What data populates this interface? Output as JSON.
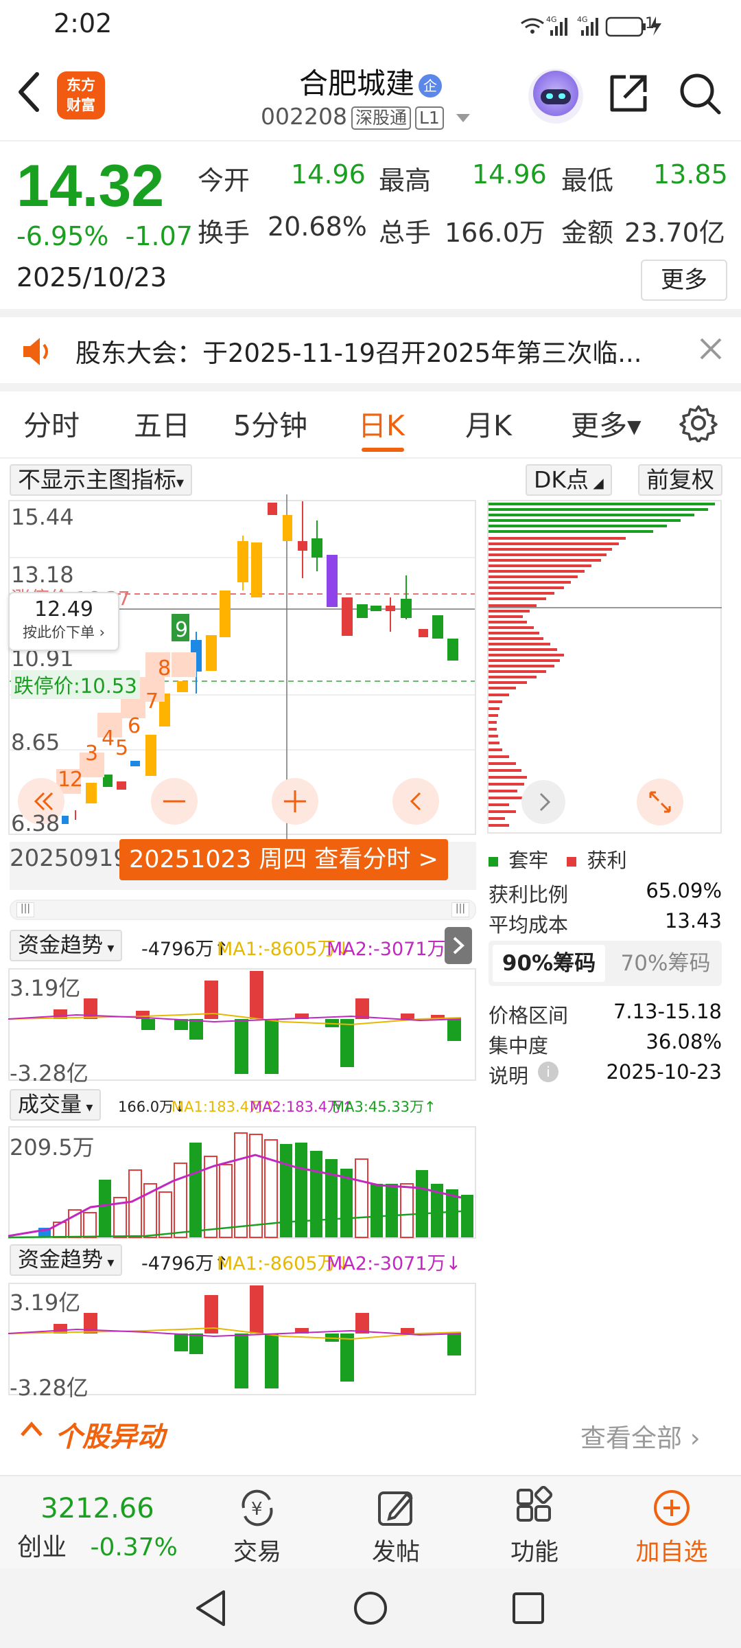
{
  "status_bar": {
    "time": "2:02",
    "battery": "1"
  },
  "header": {
    "logo_line1": "东方",
    "logo_line2": "财富",
    "stock_name": "合肥城建",
    "badge": "企",
    "stock_code": "002208",
    "tag1": "深股通",
    "tag2": "L1"
  },
  "quote": {
    "price": "14.32",
    "change_pct": "-6.95%",
    "change_amt": "-1.07",
    "date": "2025/10/23",
    "open_label": "今开",
    "open": "14.96",
    "high_label": "最高",
    "high": "14.96",
    "low_label": "最低",
    "low": "13.85",
    "turnover_label": "换手",
    "turnover": "20.68%",
    "volume_label": "总手",
    "volume": "166.0万",
    "amount_label": "金额",
    "amount": "23.70亿",
    "more_label": "更多"
  },
  "notice": {
    "text": "股东大会：于2025-11-19召开2025年第三次临..."
  },
  "tabs": [
    "分时",
    "五日",
    "5分钟",
    "日K",
    "月K",
    "更多▾"
  ],
  "active_tab": "日K",
  "kline": {
    "indicator_select": "不显示主图指标",
    "dk_label": "DK点",
    "adjust_label": "前复权",
    "price_labels": [
      "15.44",
      "13.18",
      "10.91",
      "8.65",
      "6.38"
    ],
    "limit_up_label": "涨停价:16.37",
    "limit_down_label": "跌停价:10.53",
    "cursor_price": "12.49",
    "cursor_hint": "按此价下单 ›",
    "start_date": "20250919",
    "cursor_date_btn": "20251023 周四 查看分时 >",
    "markers": [
      "1",
      "2",
      "3",
      "4",
      "5",
      "6",
      "7",
      "8",
      "9"
    ]
  },
  "chip": {
    "legend_trap": "套牢",
    "legend_profit": "获利",
    "profit_ratio_label": "获利比例",
    "profit_ratio": "65.09%",
    "avg_cost_label": "平均成本",
    "avg_cost": "13.43",
    "tab_90": "90%筹码",
    "tab_70": "70%筹码",
    "range_label": "价格区间",
    "range": "7.13-15.18",
    "concentration_label": "集中度",
    "concentration": "36.08%",
    "note_label": "说明",
    "note_date": "2025-10-23"
  },
  "fund_trend": {
    "select": "资金趋势",
    "value": "-4796万↑",
    "ma1": "MA1:-8605万↓",
    "ma2": "MA2:-3071万↓",
    "top": "3.19亿",
    "bottom": "-3.28亿"
  },
  "volume": {
    "select": "成交量",
    "value": "166.0万↓",
    "ma1": "MA1:183.4万↑",
    "ma2": "MA2:183.4万↑",
    "ma3": "MA3:45.33万↑",
    "top": "209.5万"
  },
  "fund_trend2": {
    "select": "资金趋势",
    "value": "-4796万↑",
    "ma1": "MA1:-8605万↓",
    "ma2": "MA2:-3071万↓",
    "top": "3.19亿",
    "bottom": "-3.28亿"
  },
  "anomaly": {
    "title": "个股异动",
    "view_all": "查看全部"
  },
  "bottom_nav": {
    "index_value": "3212.66",
    "index_name": "创业",
    "index_change": "-0.37%",
    "trade": "交易",
    "post": "发帖",
    "func": "功能",
    "add": "加自选"
  },
  "colors": {
    "up": "#e23c3c",
    "down": "#1aa020",
    "accent": "#f0620d"
  }
}
